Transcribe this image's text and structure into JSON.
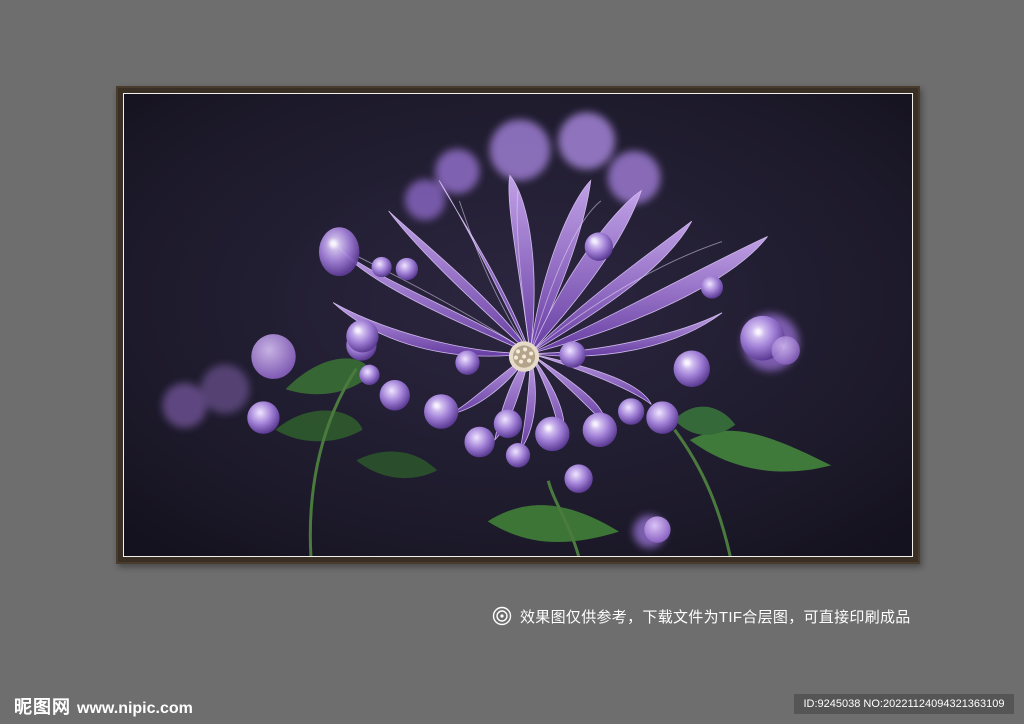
{
  "caption": {
    "icon": "target-ring-icon",
    "text": "效果图仅供参考，下载文件为TIF合层图，可直接印刷成品"
  },
  "watermark": {
    "brand": "昵图网",
    "url": "www.nipic.com"
  },
  "id_bar": {
    "text": "ID:9245038 NO:20221124094321363109"
  },
  "colors": {
    "background": "#6e6e6e",
    "frame": "#3a2f24",
    "mat": "#f3f1ec",
    "art_background": "#1e1a2c",
    "petal": "#8b63c4",
    "petal_light": "#c7a6ee",
    "leaf": "#3f7a3a"
  }
}
